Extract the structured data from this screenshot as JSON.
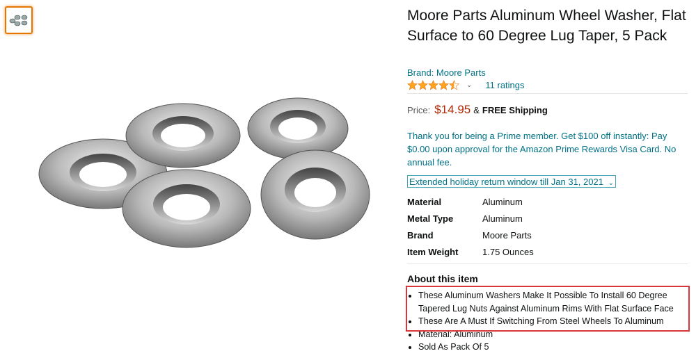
{
  "product": {
    "title": "Moore Parts Aluminum Wheel Washer, Flat Surface to 60 Degree Lug Taper, 5 Pack",
    "brand_link": "Brand: Moore Parts",
    "rating_stars": 4.5,
    "ratings_count": "11 ratings",
    "price_label": "Price:",
    "price": "$14.95",
    "amp": "&",
    "shipping": "FREE Shipping",
    "prime_offer": "Thank you for being a Prime member. Get $100 off instantly: Pay $0.00 upon approval for the Amazon Prime Rewards Visa Card. No annual fee.",
    "return_window": "Extended holiday return window till Jan 31, 2021"
  },
  "specs": [
    {
      "key": "Material",
      "value": "Aluminum"
    },
    {
      "key": "Metal Type",
      "value": "Aluminum"
    },
    {
      "key": "Brand",
      "value": "Moore Parts"
    },
    {
      "key": "Item Weight",
      "value": "1.75 Ounces"
    }
  ],
  "about": {
    "heading": "About this item",
    "bullets": [
      "These Aluminum Washers Make It Possible To Install 60 Degree Tapered Lug Nuts Against Aluminum Rims With Flat Surface Face",
      "These Are A Must If Switching From Steel Wheels To Aluminum",
      "Material: Aluminum",
      "Sold As Pack Of 5"
    ]
  },
  "colors": {
    "link": "#007185",
    "price": "#b12704",
    "star": "#ffa41c",
    "thumb_border": "#e77600",
    "highlight": "#d9363c"
  }
}
